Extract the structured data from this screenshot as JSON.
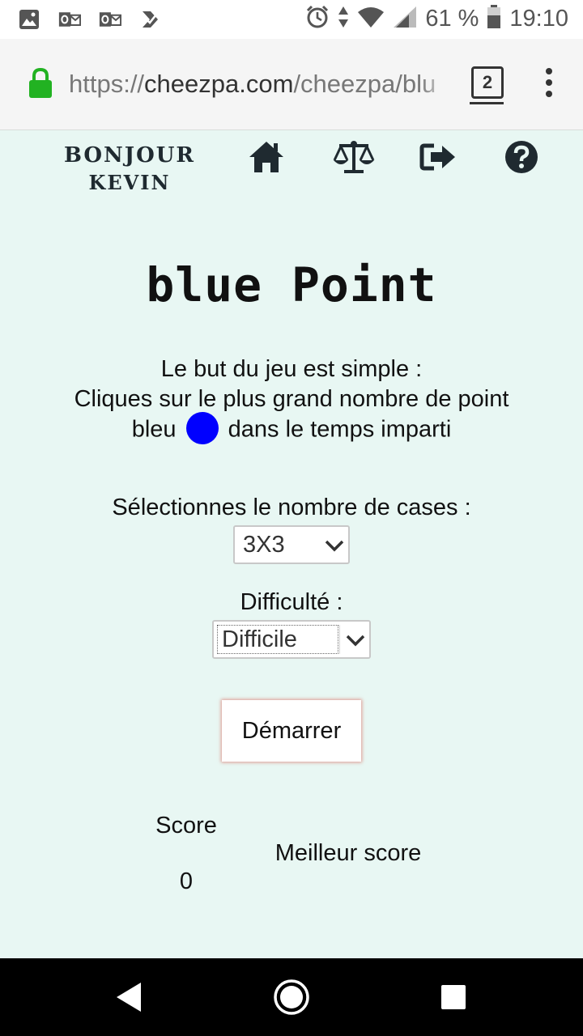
{
  "status_bar": {
    "icons_left": [
      "image-icon",
      "outlook-icon",
      "outlook-icon",
      "check-app-icon"
    ],
    "icons_right": [
      "alarm-icon",
      "data-arrows-icon",
      "wifi-icon",
      "signal-icon"
    ],
    "battery_text": "61 %",
    "time": "19:10"
  },
  "browser": {
    "url_scheme": "https://",
    "url_host": "cheezpa.com",
    "url_path": "/cheezpa/blu",
    "tab_count": "2",
    "secure_color": "#22b222"
  },
  "site_nav": {
    "greeting_line1": "Bonjour",
    "greeting_line2": "Kevin",
    "icons": [
      "home-icon",
      "balance-scale-icon",
      "sign-out-icon",
      "help-circle-icon"
    ]
  },
  "game": {
    "title": "blue Point",
    "intro_line1": "Le but du jeu est simple :",
    "intro_line2": "Cliques sur le plus grand nombre de point",
    "intro_line3_before": "bleu",
    "intro_line3_after": "dans le temps imparti",
    "dot_color": "#0000ff",
    "cases_label": "Sélectionnes le nombre de cases :",
    "cases_value": "3X3",
    "difficulty_label": "Difficulté :",
    "difficulty_value": "Difficile",
    "start_label": "Démarrer",
    "score_label": "Score",
    "score_value": "0",
    "best_score_label": "Meilleur score"
  },
  "colors": {
    "page_background": "#e8f7f3",
    "text": "#111111",
    "nav_icon": "#1f2a30"
  },
  "nav_bar": {
    "buttons": [
      "back-icon",
      "home-icon",
      "recents-icon"
    ]
  }
}
